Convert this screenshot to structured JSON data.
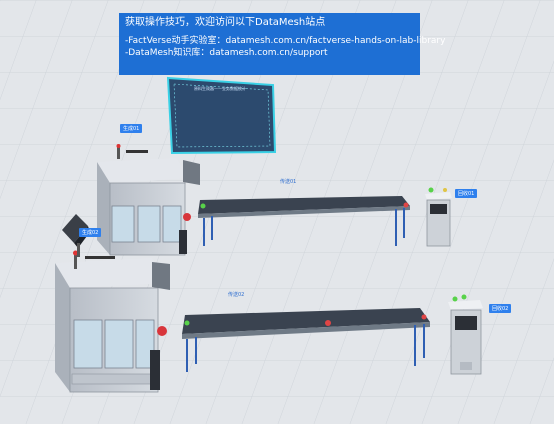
{
  "banner": {
    "title": "获取操作技巧，欢迎访问以下DataMesh站点",
    "line1": "-FactVerse动手实验室：datamesh.com.cn/factverse-hands-on-lab-library",
    "line2": "-DataMesh知识库：datamesh.com.cn/support"
  },
  "board": {
    "title": "原料生成器——业务数据统计"
  },
  "tags": {
    "gen1": "生成01",
    "gen2": "生成02",
    "recycle1": "回收01",
    "recycle2": "回收02"
  },
  "conveyor_labels": {
    "conv1": "传送01",
    "conv2": "传送02"
  },
  "colors": {
    "banner_bg": "#1e6fd4",
    "board_bg": "#2c4a6e",
    "board_glow": "#3ad1e6",
    "tag_bg": "#2f80ed",
    "machine_body": "#c9ced6",
    "belt": "#3a4350",
    "floor": "#dfe3e7"
  }
}
